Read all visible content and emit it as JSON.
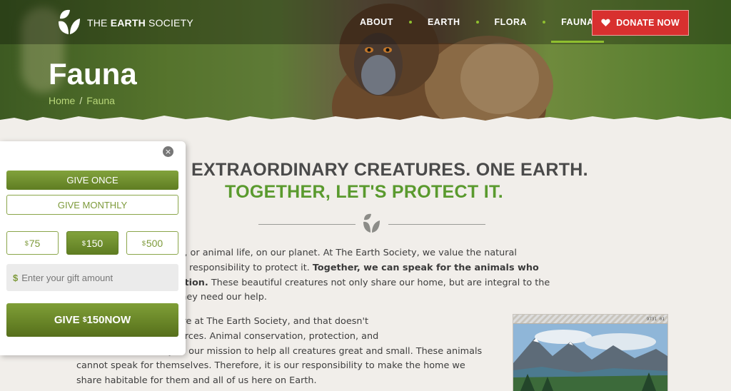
{
  "brand": {
    "name_light": "THE ",
    "name_bold": "EARTH",
    "name_rest": " SOCIETY"
  },
  "nav": {
    "items": [
      {
        "label": "ABOUT",
        "active": false
      },
      {
        "label": "EARTH",
        "active": false
      },
      {
        "label": "FLORA",
        "active": false
      },
      {
        "label": "FAUNA",
        "active": true
      }
    ],
    "donate_label": "DONATE NOW"
  },
  "hero": {
    "title": "Fauna",
    "breadcrumb": [
      "Home",
      "Fauna"
    ]
  },
  "content": {
    "headline": "EXTRAORDINARY CREATURES. ONE EARTH.",
    "subhead": "TOGETHER, LET'S PROTECT IT.",
    "p1_a": "fferent species of fauna, or animal life, on our planet. At The Earth Society, we value the natural",
    "p1_b": "nd know that we have a responsibility to protect it. ",
    "p1_bold1": "Together, we can speak for the animals who",
    "p1_bold2": "perately need protection.",
    "p1_c": " These beautiful creatures not only share our home, but are integral to the",
    "p1_d": "osystems. Right now, they need our help.",
    "p2_a": "heart of what we do here at The Earth Society, and that doesn't",
    "p2_b": "natural lands and resources. Animal conservation, protection, and",
    "p2_c": "rehabilitation are key to our mission to help all creatures great and small. These animals",
    "p2_d": "cannot speak for themselves. Therefore, it is our responsibility to make the home we",
    "p2_e": "share habitable for them and all of us here on Earth.",
    "photo_stamp": "9731 01"
  },
  "widget": {
    "give_once": "GIVE ONCE",
    "give_monthly": "GIVE MONTHLY",
    "currency": "$",
    "amounts": [
      "75",
      "150",
      "500"
    ],
    "selected_amount": "150",
    "gift_placeholder": "Enter your gift amount",
    "give_prefix": "GIVE ",
    "give_suffix": " NOW",
    "close_symbol": "×"
  },
  "colors": {
    "accent_green": "#5a9a2e",
    "donate_red": "#d8302f",
    "nav_dot": "#8fbf2f"
  }
}
